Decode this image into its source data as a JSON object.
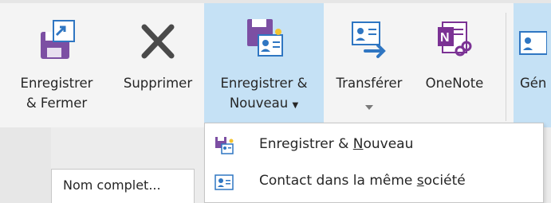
{
  "ribbon": {
    "buttons": [
      {
        "id": "save-close",
        "line1": "Enregistrer",
        "line2": "& Fermer",
        "icon": "save-close-icon"
      },
      {
        "id": "delete",
        "line1": "Supprimer",
        "line2": "",
        "icon": "delete-x-icon"
      },
      {
        "id": "save-new",
        "line1": "Enregistrer &",
        "line2": "Nouveau",
        "icon": "save-new-contact-icon"
      },
      {
        "id": "forward",
        "line1": "Transférer",
        "line2": "",
        "icon": "forward-contact-icon"
      },
      {
        "id": "onenote",
        "line1": "OneNote",
        "line2": "",
        "icon": "onenote-icon"
      },
      {
        "id": "general",
        "line1": "Gén",
        "line2": "",
        "icon": "contact-card-icon"
      }
    ]
  },
  "dropdown": {
    "items": [
      {
        "prefix": "Enregistrer & ",
        "accel": "N",
        "suffix": "ouveau",
        "icon": "save-new-small-icon"
      },
      {
        "prefix": "Contact dans la même ",
        "accel": "s",
        "suffix": "ociété",
        "icon": "contact-card-small-icon"
      }
    ]
  },
  "form": {
    "full_name_label": "Nom complet..."
  },
  "colors": {
    "active_button_bg": "#c5e1f5",
    "purple": "#7c4fa3",
    "blue": "#2f76c2",
    "onenote": "#7b3294"
  }
}
